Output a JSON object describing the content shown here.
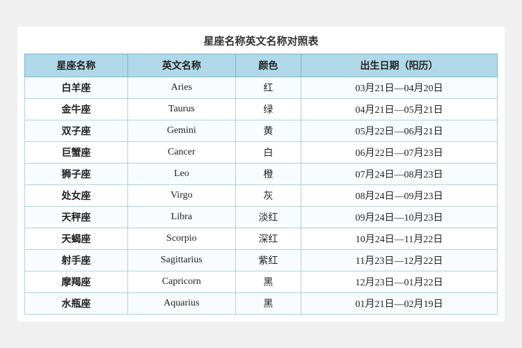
{
  "title": "星座名称英文名称对照表",
  "table": {
    "headers": [
      "星座名称",
      "英文名称",
      "颜色",
      "出生日期（阳历）"
    ],
    "rows": [
      [
        "白羊座",
        "Aries",
        "红",
        "03月21日—04月20日"
      ],
      [
        "金牛座",
        "Taurus",
        "绿",
        "04月21日—05月21日"
      ],
      [
        "双子座",
        "Gemini",
        "黄",
        "05月22日—06月21日"
      ],
      [
        "巨蟹座",
        "Cancer",
        "白",
        "06月22日—07月23日"
      ],
      [
        "狮子座",
        "Leo",
        "橙",
        "07月24日—08月23日"
      ],
      [
        "处女座",
        "Virgo",
        "灰",
        "08月24日—09月23日"
      ],
      [
        "天秤座",
        "Libra",
        "淡红",
        "09月24日—10月23日"
      ],
      [
        "天蝎座",
        "Scorpio",
        "深红",
        "10月24日—11月22日"
      ],
      [
        "射手座",
        "Sagittarius",
        "紫红",
        "11月23日—12月22日"
      ],
      [
        "摩羯座",
        "Capricorn",
        "黑",
        "12月23日—01月22日"
      ],
      [
        "水瓶座",
        "Aquarius",
        "黑",
        "01月21日—02月19日"
      ]
    ]
  }
}
